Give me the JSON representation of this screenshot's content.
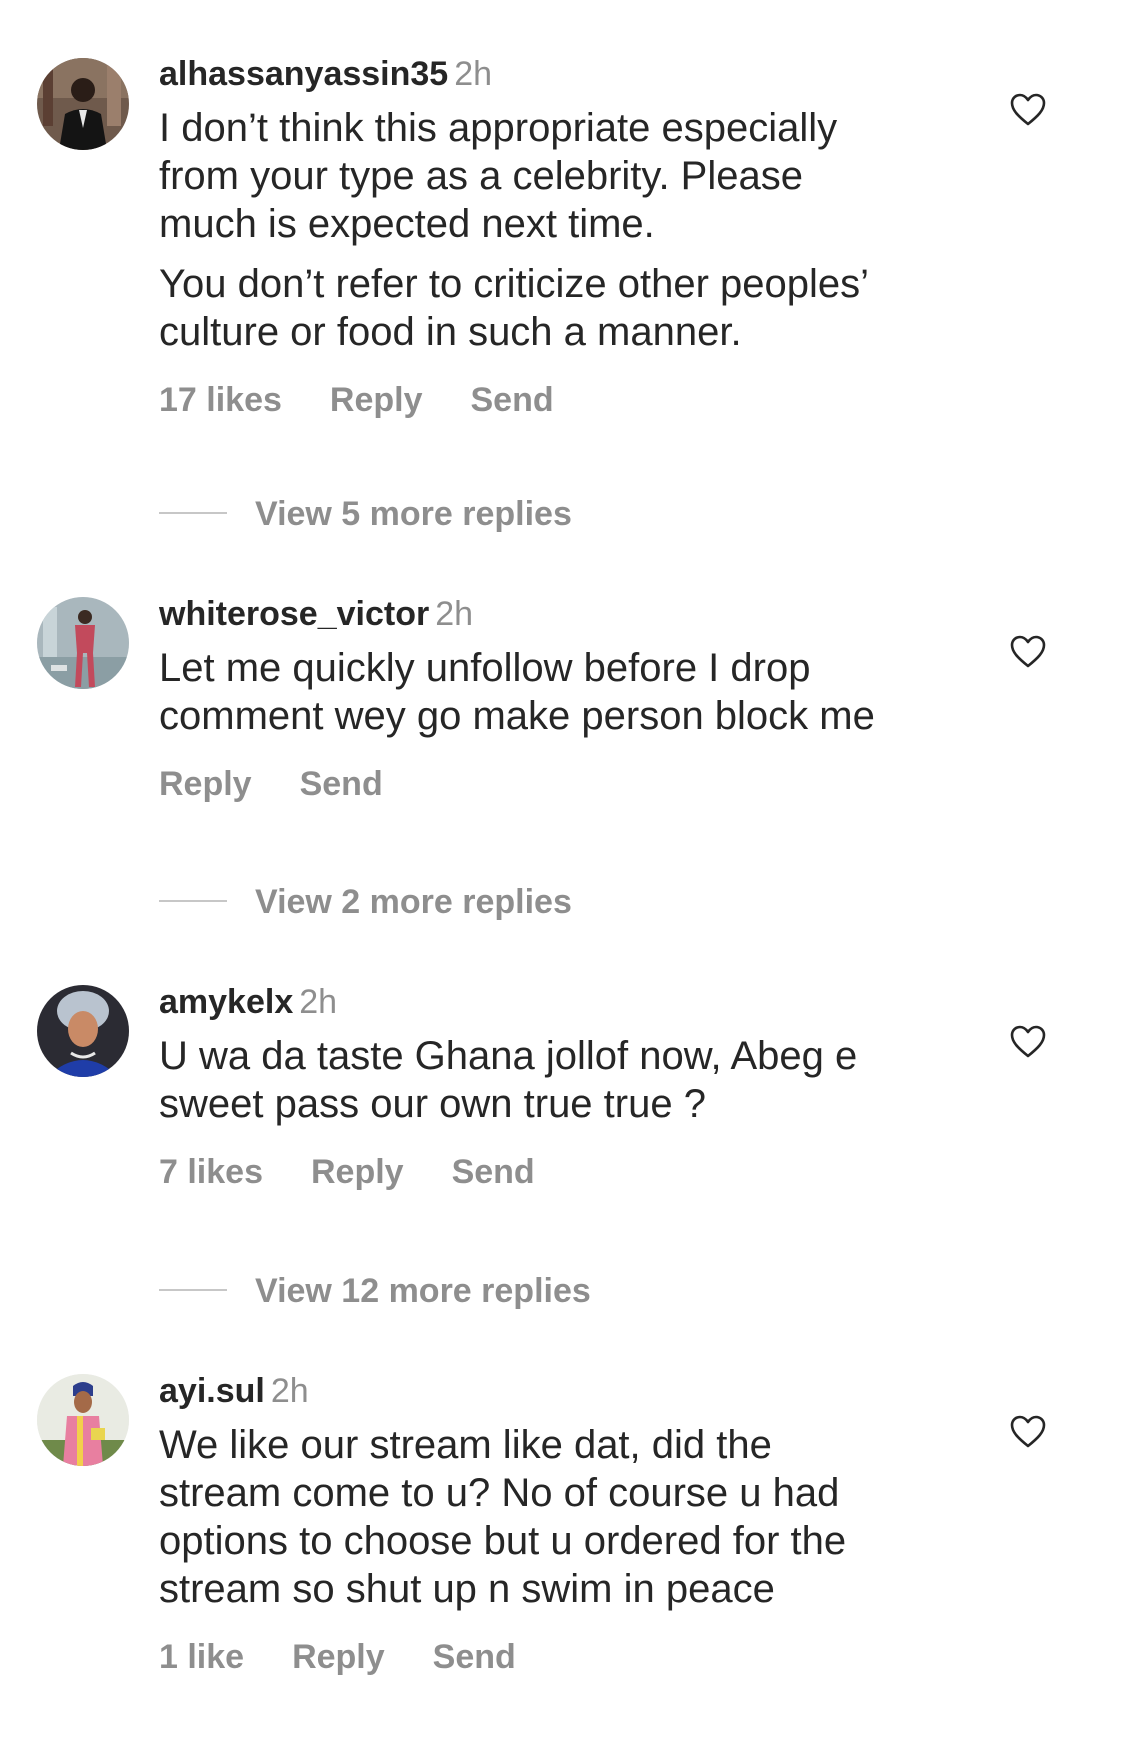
{
  "comments": [
    {
      "username": "alhassanyassin35",
      "time": "2h",
      "paragraphs": [
        "I don’t think this appropriate especially\nfrom your type as a celebrity. Please\nmuch is expected next time.",
        "You don’t refer to criticize other peoples’\nculture or food in such a manner."
      ],
      "likes": "17 likes",
      "reply": "Reply",
      "send": "Send",
      "view_replies": "View 5 more replies"
    },
    {
      "username": "whiterose_victor",
      "time": "2h",
      "paragraphs": [
        "Let me quickly unfollow before I drop\ncomment wey go make person block me"
      ],
      "reply": "Reply",
      "send": "Send",
      "view_replies": "View 2 more replies"
    },
    {
      "username": "amykelx",
      "time": "2h",
      "paragraphs": [
        "U wa da taste Ghana jollof now, Abeg e\nsweet pass our own true true ?"
      ],
      "likes": "7 likes",
      "reply": "Reply",
      "send": "Send",
      "view_replies": "View 12 more replies"
    },
    {
      "username": "ayi.sul",
      "time": "2h",
      "paragraphs": [
        "We like our stream like dat,  did the\nstream come to u? No of course u had\noptions to choose but u ordered for the\nstream so shut up n swim in peace"
      ],
      "likes": "1 like",
      "reply": "Reply",
      "send": "Send"
    }
  ],
  "icons": {
    "like": "heart-outline-icon"
  },
  "colors": {
    "primary_text": "#262626",
    "secondary_text": "#8e8e8e",
    "divider": "#c7c7c7"
  }
}
